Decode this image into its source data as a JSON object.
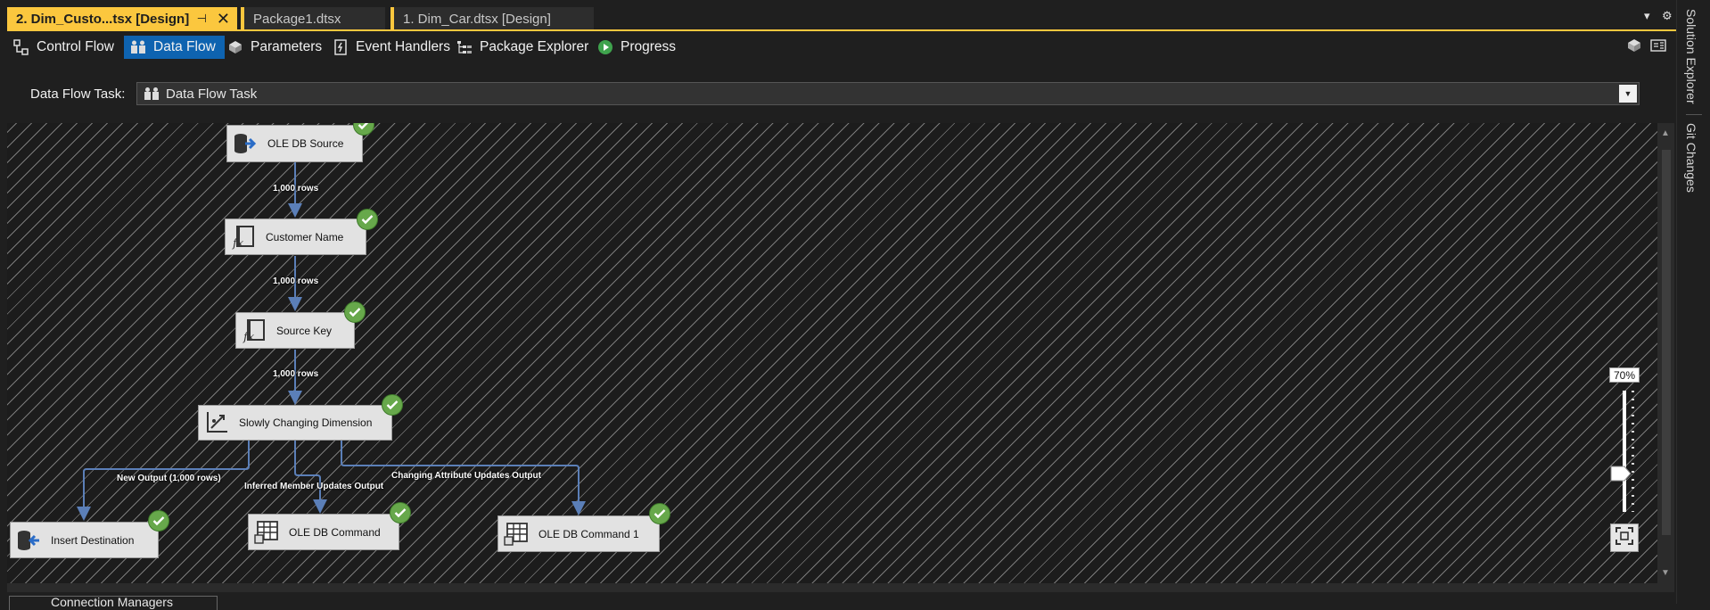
{
  "document_tabs": [
    {
      "label": "2. Dim_Custo...tsx [Design]",
      "active": true
    },
    {
      "label": "Package1.dtsx",
      "active": false
    },
    {
      "label": "1. Dim_Car.dtsx [Design]",
      "active": false
    }
  ],
  "designer_tabs": [
    {
      "label": "Control Flow",
      "icon": "control-flow-icon",
      "selected": false
    },
    {
      "label": "Data Flow",
      "icon": "data-flow-icon",
      "selected": true
    },
    {
      "label": "Parameters",
      "icon": "parameters-icon",
      "selected": false
    },
    {
      "label": "Event Handlers",
      "icon": "event-handlers-icon",
      "selected": false
    },
    {
      "label": "Package Explorer",
      "icon": "package-explorer-icon",
      "selected": false
    },
    {
      "label": "Progress",
      "icon": "progress-play-icon",
      "selected": false
    }
  ],
  "task_selector": {
    "label": "Data Flow Task:",
    "value": "Data Flow Task"
  },
  "components": [
    {
      "name": "OLE DB Source",
      "icon": "ole-db-source-icon",
      "status": "success"
    },
    {
      "name": "Customer Name",
      "icon": "derived-column-icon",
      "status": "success"
    },
    {
      "name": "Source Key",
      "icon": "derived-column-icon",
      "status": "success"
    },
    {
      "name": "Slowly Changing Dimension",
      "icon": "slowly-changing-dimension-icon",
      "status": "success"
    },
    {
      "name": "Insert Destination",
      "icon": "ole-db-destination-icon",
      "status": "success"
    },
    {
      "name": "OLE DB Command",
      "icon": "ole-db-command-icon",
      "status": "success"
    },
    {
      "name": "OLE DB Command 1",
      "icon": "ole-db-command-icon",
      "status": "success"
    }
  ],
  "paths": [
    {
      "label": "1,000 rows"
    },
    {
      "label": "1,000 rows"
    },
    {
      "label": "1,000 rows"
    },
    {
      "label": "New Output (1,000 rows)"
    },
    {
      "label": "Inferred Member Updates Output"
    },
    {
      "label": "Changing Attribute Updates Output"
    }
  ],
  "zoom": {
    "value": "70%",
    "level": 0.7
  },
  "bottom_tab": {
    "label": "Connection Managers"
  },
  "side_panel": [
    {
      "label": "Solution Explorer"
    },
    {
      "label": "Git Changes"
    }
  ],
  "colors": {
    "accent_tab": "#fbc73e",
    "selected_designer_tab": "#0e63b0",
    "success_badge": "#67a84b",
    "canvas_background": "#1c1c1c"
  }
}
